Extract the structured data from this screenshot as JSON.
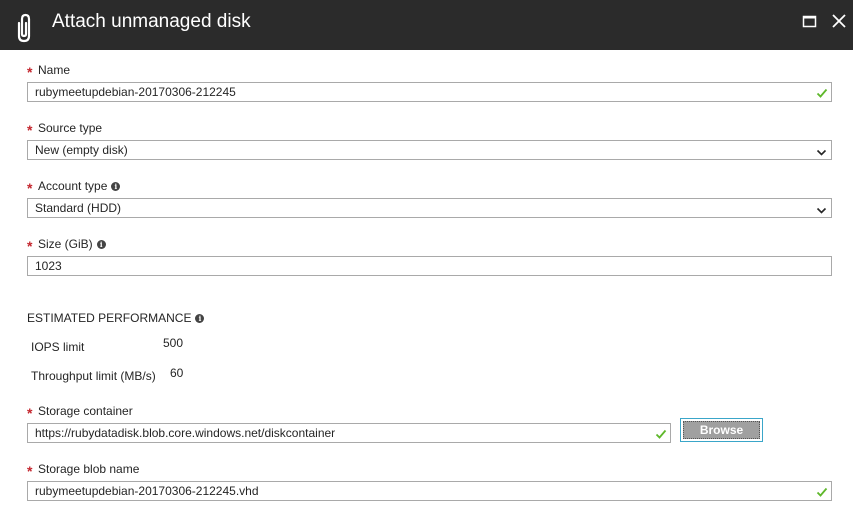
{
  "window": {
    "title": "Attach unmanaged disk",
    "title_icon": "paperclip-icon",
    "maximize_icon": "maximize-icon",
    "close_icon": "close-icon"
  },
  "colors": {
    "titlebar_bg": "#2b2b2b",
    "required_star": "#c4262e",
    "valid_check": "#5fb82b",
    "browse_border": "#3aa6c9",
    "browse_bg": "#a0a0a0"
  },
  "form": {
    "required_marker": "*",
    "name": {
      "label": "Name",
      "value": "rubymeetupdebian-20170306-212245",
      "valid": true
    },
    "source_type": {
      "label": "Source type",
      "selected": "New (empty disk)"
    },
    "account_type": {
      "label": "Account type",
      "selected": "Standard (HDD)"
    },
    "size": {
      "label": "Size (GiB)",
      "value": "1023"
    },
    "estimated_performance": {
      "title": "ESTIMATED PERFORMANCE",
      "iops_label": "IOPS limit",
      "iops_value": "500",
      "throughput_label": "Throughput limit (MB/s)",
      "throughput_value": "60"
    },
    "storage_container": {
      "label": "Storage container",
      "value": "https://rubydatadisk.blob.core.windows.net/diskcontainer",
      "valid": true,
      "browse_label": "Browse"
    },
    "storage_blob_name": {
      "label": "Storage blob name",
      "value": "rubymeetupdebian-20170306-212245.vhd",
      "valid": true
    }
  }
}
